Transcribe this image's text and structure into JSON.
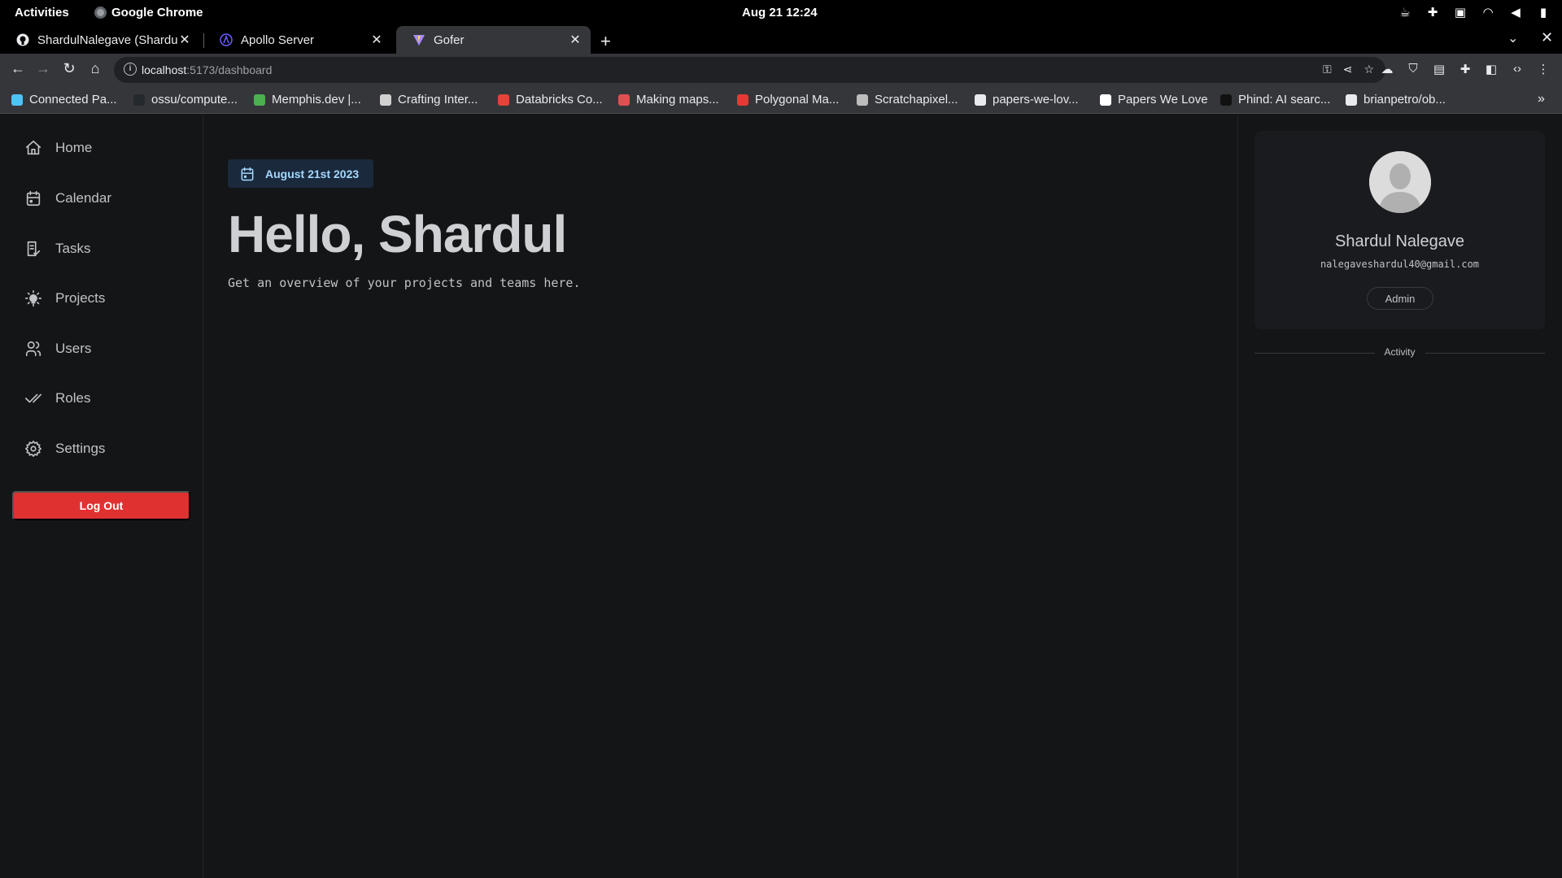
{
  "system_bar": {
    "activities": "Activities",
    "app_name": "Google Chrome",
    "clock": "Aug 21  12:24"
  },
  "tabs": [
    {
      "label": "ShardulNalegave (Shardul",
      "active": false
    },
    {
      "label": "Apollo Server",
      "active": false
    },
    {
      "label": "Gofer",
      "active": true
    }
  ],
  "address_bar": {
    "host": "localhost",
    "path": ":5173/dashboard"
  },
  "bookmarks": [
    {
      "label": "Connected Pa...",
      "icon_color": "#4fc3f7"
    },
    {
      "label": "ossu/compute...",
      "icon_color": "#24292e"
    },
    {
      "label": "Memphis.dev |...",
      "icon_color": "#4caf50"
    },
    {
      "label": "Crafting Inter...",
      "icon_color": "#d0d0d0"
    },
    {
      "label": "Databricks Co...",
      "icon_color": "#e0443a"
    },
    {
      "label": "Making maps...",
      "icon_color": "#e05050"
    },
    {
      "label": "Polygonal Ma...",
      "icon_color": "#e53935"
    },
    {
      "label": "Scratchapixel...",
      "icon_color": "#bdbdbd"
    },
    {
      "label": "papers-we-lov...",
      "icon_color": "#e8eaed"
    },
    {
      "label": "Papers We Love",
      "icon_color": "#ffffff"
    },
    {
      "label": "Phind: AI searc...",
      "icon_color": "#111111"
    },
    {
      "label": "brianpetro/ob...",
      "icon_color": "#e8eaed"
    }
  ],
  "sidebar": {
    "items": [
      {
        "label": "Home",
        "icon": "home-icon",
        "active": true
      },
      {
        "label": "Calendar",
        "icon": "calendar-icon",
        "active": false
      },
      {
        "label": "Tasks",
        "icon": "tasks-icon",
        "active": false
      },
      {
        "label": "Projects",
        "icon": "bulb-icon",
        "active": false
      },
      {
        "label": "Users",
        "icon": "users-icon",
        "active": false
      },
      {
        "label": "Roles",
        "icon": "checks-icon",
        "active": false
      },
      {
        "label": "Settings",
        "icon": "gear-icon",
        "active": false
      }
    ],
    "logout_label": "Log Out"
  },
  "main": {
    "date": "August 21st 2023",
    "greeting": "Hello, Shardul",
    "subtitle": "Get an overview of your projects and teams here."
  },
  "profile": {
    "name": "Shardul Nalegave",
    "email": "nalegaveshardul40@gmail.com",
    "role": "Admin",
    "activity_label": "Activity"
  },
  "colors": {
    "background": "#141517",
    "accent": "#74c0fc",
    "danger": "#e03131"
  }
}
